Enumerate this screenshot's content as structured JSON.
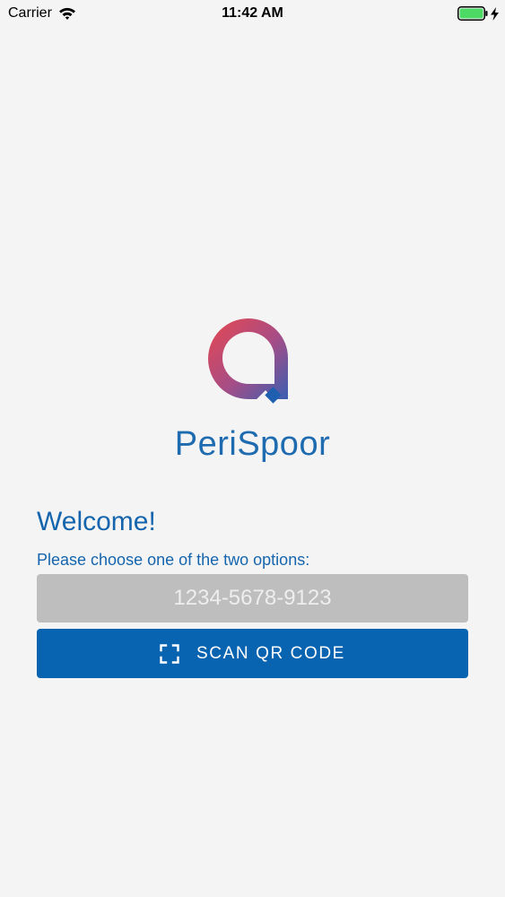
{
  "status_bar": {
    "carrier": "Carrier",
    "time": "11:42 AM",
    "wifi_icon": "wifi-icon",
    "battery_icon": "battery-full-icon",
    "charging_icon": "charging-bolt-icon"
  },
  "brand": {
    "name": "PeriSpoor",
    "logo": "perispoor-logo",
    "colors": {
      "gradient_start": "#e8474f",
      "gradient_end": "#3a5fb1",
      "text": "#1f6bb0"
    }
  },
  "welcome": {
    "title": "Welcome!",
    "instructions": "Please choose one of the two options:"
  },
  "code_input": {
    "value": "",
    "placeholder": "1234-5678-9123"
  },
  "scan_button": {
    "icon": "qr-scan-icon",
    "label": "SCAN QR CODE"
  },
  "colors": {
    "background": "#f5f4f5",
    "accent": "#0864b0",
    "input_background": "#bfbebf",
    "battery": "#4cd964"
  }
}
